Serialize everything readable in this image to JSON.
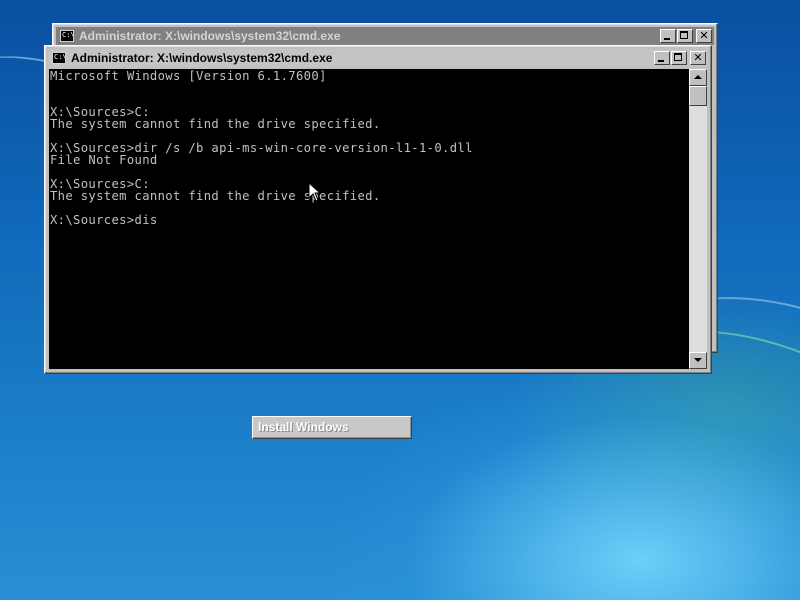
{
  "desktop": {
    "install_button_label": "Install Windows"
  },
  "back_window": {
    "title": "Administrator: X:\\windows\\system32\\cmd.exe",
    "icon_label": "C:\\"
  },
  "front_window": {
    "title": "Administrator: X:\\windows\\system32\\cmd.exe",
    "icon_label": "C:\\",
    "console_lines": [
      "Microsoft Windows [Version 6.1.7600]",
      "",
      "",
      "X:\\Sources>C:",
      "The system cannot find the drive specified.",
      "",
      "X:\\Sources>dir /s /b api-ms-win-core-version-l1-1-0.dll",
      "File Not Found",
      "",
      "X:\\Sources>C:",
      "The system cannot find the drive specified.",
      "",
      "X:\\Sources>dis"
    ]
  },
  "icons": {
    "console_app": "cmd-icon",
    "minimize": "minimize-icon",
    "maximize": "maximize-icon",
    "close": "close-icon",
    "scroll_up": "scroll-up-arrow-icon",
    "scroll_down": "scroll-down-arrow-icon",
    "pointer": "mouse-cursor-icon"
  },
  "colors": {
    "console_background": "#000000",
    "console_text": "#c0c0c0",
    "window_frame": "#c0c0c0",
    "desktop_blue": "#0f66b8"
  }
}
